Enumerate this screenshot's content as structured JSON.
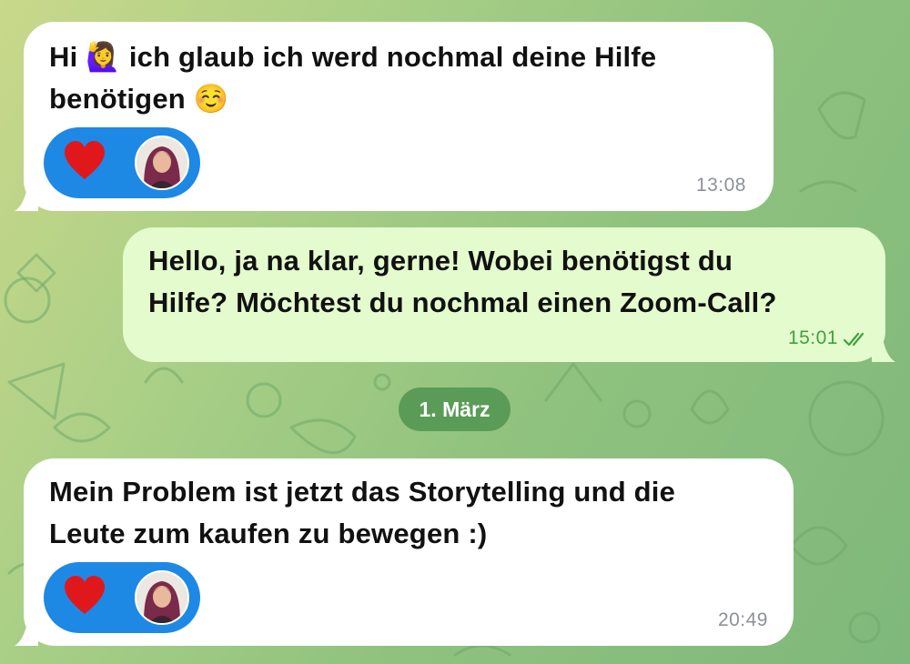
{
  "chat": {
    "messages": [
      {
        "direction": "incoming",
        "text_line1_a": "Hi ",
        "text_line1_b": " ich glaub ich werd nochmal deine Hilfe",
        "text_line2": "benötigen ",
        "emoji_a": "🙋‍♀️",
        "emoji_b": "☺️",
        "reaction": "heart-icon",
        "time": "13:08"
      },
      {
        "direction": "outgoing",
        "text_line1": "Hello, ja na klar, gerne! Wobei benötigst du",
        "text_line2": "Hilfe? Möchtest du nochmal einen Zoom-Call?",
        "time": "15:01",
        "status": "read-double-check"
      },
      {
        "direction": "incoming",
        "text_line1": "Mein Problem ist jetzt das Storytelling und die",
        "text_line2": "Leute zum kaufen zu bewegen :)",
        "reaction": "heart-icon",
        "time": "20:49"
      }
    ],
    "date_separator": "1. März"
  },
  "colors": {
    "incoming_bubble": "#ffffff",
    "outgoing_bubble": "#e4fbcd",
    "reaction_pill": "#1e88e5",
    "date_chip": "#5a9c57",
    "outgoing_time": "#3fa23f",
    "incoming_time": "#8d9196",
    "heart": "#e0181c"
  }
}
